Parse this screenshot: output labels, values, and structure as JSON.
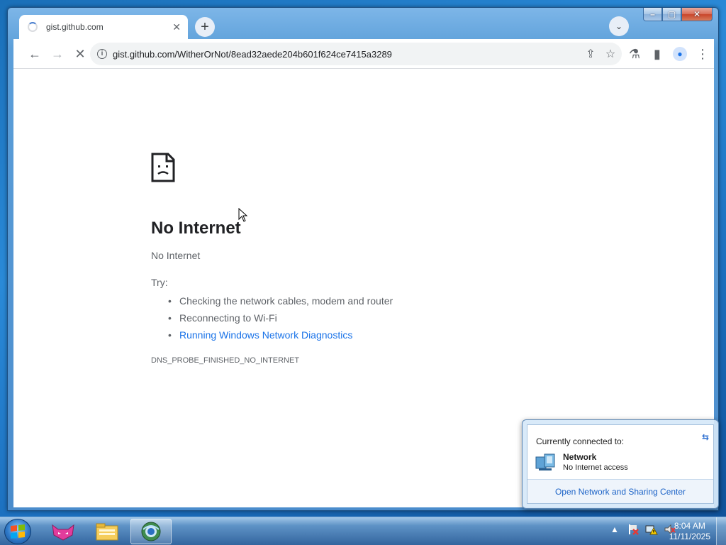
{
  "tab": {
    "title": "gist.github.com",
    "close": "✕"
  },
  "new_tab": "+",
  "tab_search": "⌄",
  "window_controls": {
    "minimize": "–",
    "maximize": "▢",
    "close": "✕"
  },
  "toolbar": {
    "back": "←",
    "forward": "→",
    "stop": "✕",
    "info": "i",
    "url": "gist.github.com/WitherOrNot/8ead32aede204b601f624ce7415a3289",
    "share": "⇪",
    "bookmark": "☆",
    "extensions": "⚗",
    "side_panel": "▮",
    "menu": "⋮"
  },
  "error": {
    "title": "No Internet",
    "subtitle": "No Internet",
    "try_label": "Try:",
    "suggestions": [
      "Checking the network cables, modem and router",
      "Reconnecting to Wi-Fi"
    ],
    "diagnostics_link": "Running Windows Network Diagnostics",
    "code": "DNS_PROBE_FINISHED_NO_INTERNET"
  },
  "network_flyout": {
    "heading": "Currently connected to:",
    "refresh": "⇆",
    "network_name": "Network",
    "network_status": "No Internet access",
    "footer_link": "Open Network and Sharing Center"
  },
  "taskbar": {
    "apps": [
      {
        "name": "app-fox",
        "active": false
      },
      {
        "name": "file-explorer",
        "active": false
      },
      {
        "name": "browser",
        "active": true
      }
    ],
    "tray": {
      "show_hidden": "▲"
    },
    "clock": {
      "time": "8:04 AM",
      "date": "11/11/2025"
    }
  },
  "colors": {
    "link": "#1a73e8",
    "desktop": "#1a6fb8",
    "taskbar": "#34659e"
  }
}
